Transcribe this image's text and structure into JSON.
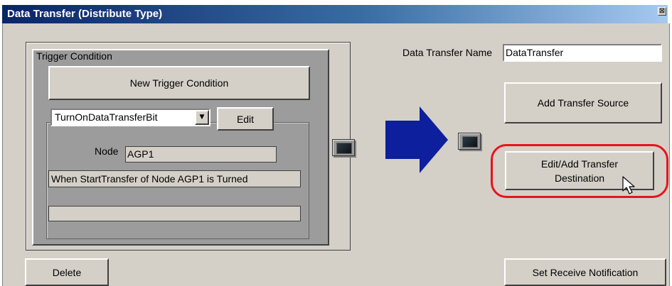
{
  "window": {
    "title": "Data Transfer (Distribute Type)",
    "close_glyph": "⊠"
  },
  "trigger": {
    "group_label": "Trigger Condition",
    "new_button": "New Trigger Condition",
    "selected_condition": "TurnOnDataTransferBit",
    "dropdown_glyph": "▼",
    "edit_button": "Edit",
    "node_label": "Node",
    "node_value": "AGP1",
    "description": "When StartTransfer of Node AGP1 is Turned",
    "extra_value": ""
  },
  "transfer": {
    "name_label": "Data Transfer Name",
    "name_value": "DataTransfer",
    "add_source_button": "Add Transfer Source",
    "edit_destination_line1": "Edit/Add Transfer",
    "edit_destination_line2": "Destination"
  },
  "footer": {
    "delete_button": "Delete",
    "notification_button": "Set Receive Notification"
  },
  "icons": {
    "source_device": "monitor-icon",
    "destination_device": "monitor-icon",
    "flow": "arrow-right-icon",
    "pointer": "mouse-cursor-icon"
  },
  "colors": {
    "title_bar_start": "#0a246a",
    "title_bar_end": "#a6caf0",
    "dialog_face": "#d4d0c8",
    "trigger_panel": "#9c9c9c",
    "arrow": "#0d1f9c",
    "highlight_ring": "#e8141c"
  }
}
